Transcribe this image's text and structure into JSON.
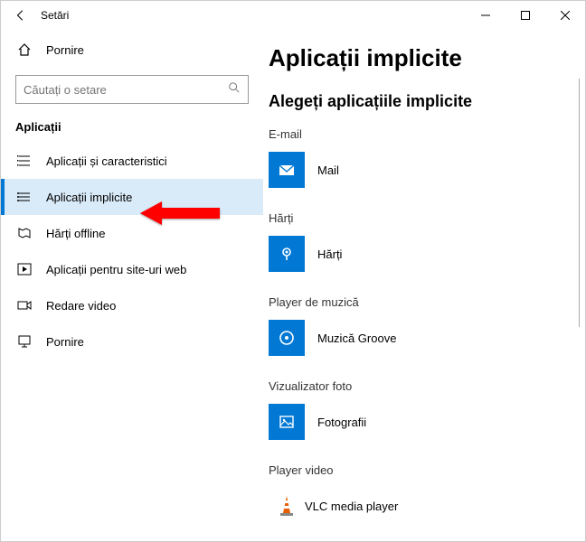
{
  "titlebar": {
    "title": "Setări"
  },
  "sidebar": {
    "home": "Pornire",
    "search_placeholder": "Căutați o setare",
    "group": "Aplicații",
    "items": [
      {
        "label": "Aplicații și caracteristici",
        "selected": false
      },
      {
        "label": "Aplicații implicite",
        "selected": true
      },
      {
        "label": "Hărți offline",
        "selected": false
      },
      {
        "label": "Aplicații pentru site-uri web",
        "selected": false
      },
      {
        "label": "Redare video",
        "selected": false
      },
      {
        "label": "Pornire",
        "selected": false
      }
    ]
  },
  "main": {
    "heading": "Aplicații implicite",
    "subheading": "Alegeți aplicațiile implicite",
    "categories": [
      {
        "label": "E-mail",
        "app": "Mail",
        "icon": "mail"
      },
      {
        "label": "Hărți",
        "app": "Hărți",
        "icon": "maps"
      },
      {
        "label": "Player de muzică",
        "app": "Muzică Groove",
        "icon": "groove"
      },
      {
        "label": "Vizualizator foto",
        "app": "Fotografii",
        "icon": "photos"
      },
      {
        "label": "Player video",
        "app": "VLC media player",
        "icon": "vlc"
      }
    ]
  }
}
